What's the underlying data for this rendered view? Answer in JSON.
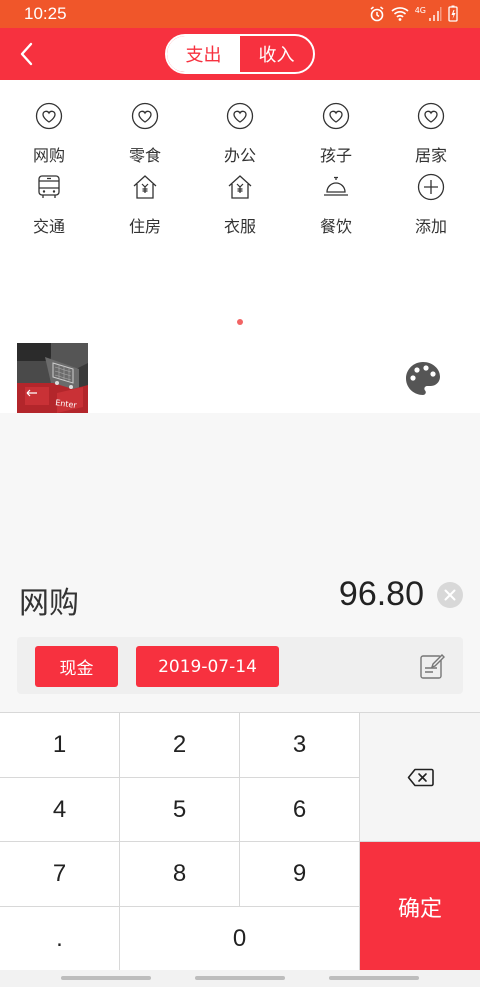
{
  "status_bar": {
    "time": "10:25",
    "icons": [
      "alarm-icon",
      "wifi-icon",
      "signal-icon",
      "battery-icon"
    ],
    "network": "4G"
  },
  "header": {
    "back_icon": "chevron-left-icon",
    "tabs": [
      {
        "label": "支出",
        "active": true
      },
      {
        "label": "收入",
        "active": false
      }
    ]
  },
  "categories": [
    {
      "label": "网购",
      "icon": "heart-icon"
    },
    {
      "label": "零食",
      "icon": "heart-icon"
    },
    {
      "label": "办公",
      "icon": "heart-icon"
    },
    {
      "label": "孩子",
      "icon": "heart-icon"
    },
    {
      "label": "居家",
      "icon": "heart-icon"
    },
    {
      "label": "交通",
      "icon": "bus-icon"
    },
    {
      "label": "住房",
      "icon": "house-yen-icon"
    },
    {
      "label": "衣服",
      "icon": "house-yen-icon"
    },
    {
      "label": "餐饮",
      "icon": "cloche-icon"
    },
    {
      "label": "添加",
      "icon": "add-circle-icon"
    }
  ],
  "pager": {
    "pages": 1,
    "current": 1
  },
  "entry": {
    "category": "网购",
    "amount": "96.80"
  },
  "options": {
    "account": "现金",
    "date": "2019-07-14"
  },
  "keypad": {
    "keys": [
      "1",
      "2",
      "3",
      "4",
      "5",
      "6",
      "7",
      "8",
      "9",
      ".",
      "0"
    ],
    "confirm_label": "确定"
  },
  "colors": {
    "primary": "#f7313f",
    "status_bar": "#f0562a"
  }
}
